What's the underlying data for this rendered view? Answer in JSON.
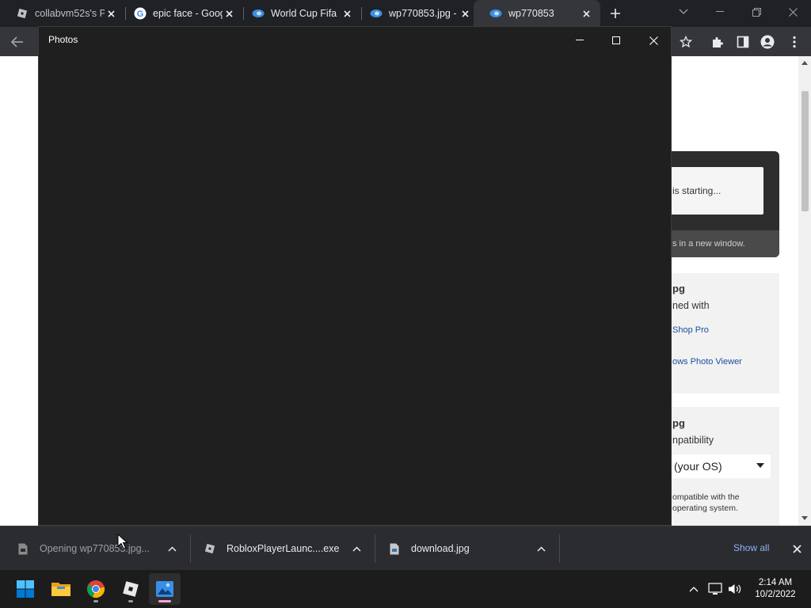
{
  "browser": {
    "tabs": [
      {
        "title": "collabvm52s's Pl",
        "icon": "roblox-icon"
      },
      {
        "title": "epic face - Goog",
        "icon": "google-icon"
      },
      {
        "title": "World Cup Fifa",
        "icon": "edge-photo-icon"
      },
      {
        "title": "wp770853.jpg -",
        "icon": "edge-photo-icon"
      },
      {
        "title": "wp770853",
        "icon": "edge-photo-icon"
      }
    ]
  },
  "page": {
    "starting_text": "is starting...",
    "new_window_text": "s in a new window.",
    "card1": {
      "heading": "pg",
      "opened_with": "ned with",
      "link1": "Shop Pro",
      "link2": "ows Photo Viewer"
    },
    "card2": {
      "heading": "pg",
      "compat": "npatibility",
      "select_value": "(your OS)",
      "note_line1": "ompatible with the",
      "note_line2": "operating system."
    }
  },
  "photos": {
    "title": "Photos"
  },
  "downloads": {
    "items": [
      {
        "label": "Opening wp770853.jpg..."
      },
      {
        "label": "RobloxPlayerLaunc....exe"
      },
      {
        "label": "download.jpg"
      }
    ],
    "show_all": "Show all"
  },
  "taskbar": {
    "time": "2:14 AM",
    "date": "10/2/2022"
  },
  "colors": {
    "accent": "#8ab4f8",
    "link": "#1a4d9c"
  }
}
